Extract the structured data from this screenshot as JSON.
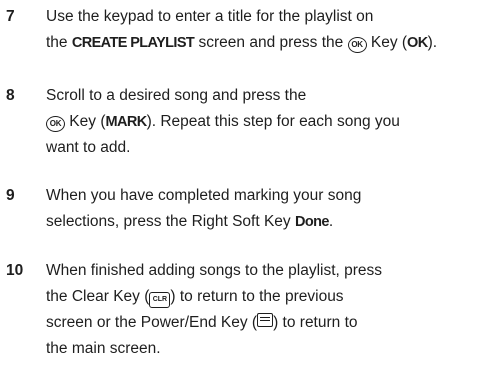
{
  "steps": [
    {
      "number": "7",
      "t1": "Use the keypad to enter a title for the playlist on",
      "t2": "the ",
      "screen_name": "CREATE PLAYLIST",
      "t3": " screen and press the ",
      "key_icon": "OK",
      "t4": " Key (",
      "key_label": "OK",
      "t5": ")."
    },
    {
      "number": "8",
      "t1": "Scroll to a desired song and press the",
      "key_icon": "OK",
      "t2": " Key (",
      "key_label": "MARK",
      "t3": "). Repeat this step for each song you",
      "t4": "want to add."
    },
    {
      "number": "9",
      "t1": "When you have completed marking your song",
      "t2": "selections, press the Right Soft Key ",
      "key_label": "Done",
      "t3": "."
    },
    {
      "number": "10",
      "t1": "When finished adding songs to the playlist, press",
      "t2": "the Clear Key (",
      "clr_icon": "CLR",
      "t3": ") to return to the previous",
      "t4": "screen or the Power/End Key (",
      "t5": ") to return to",
      "t6": "the main screen."
    }
  ]
}
